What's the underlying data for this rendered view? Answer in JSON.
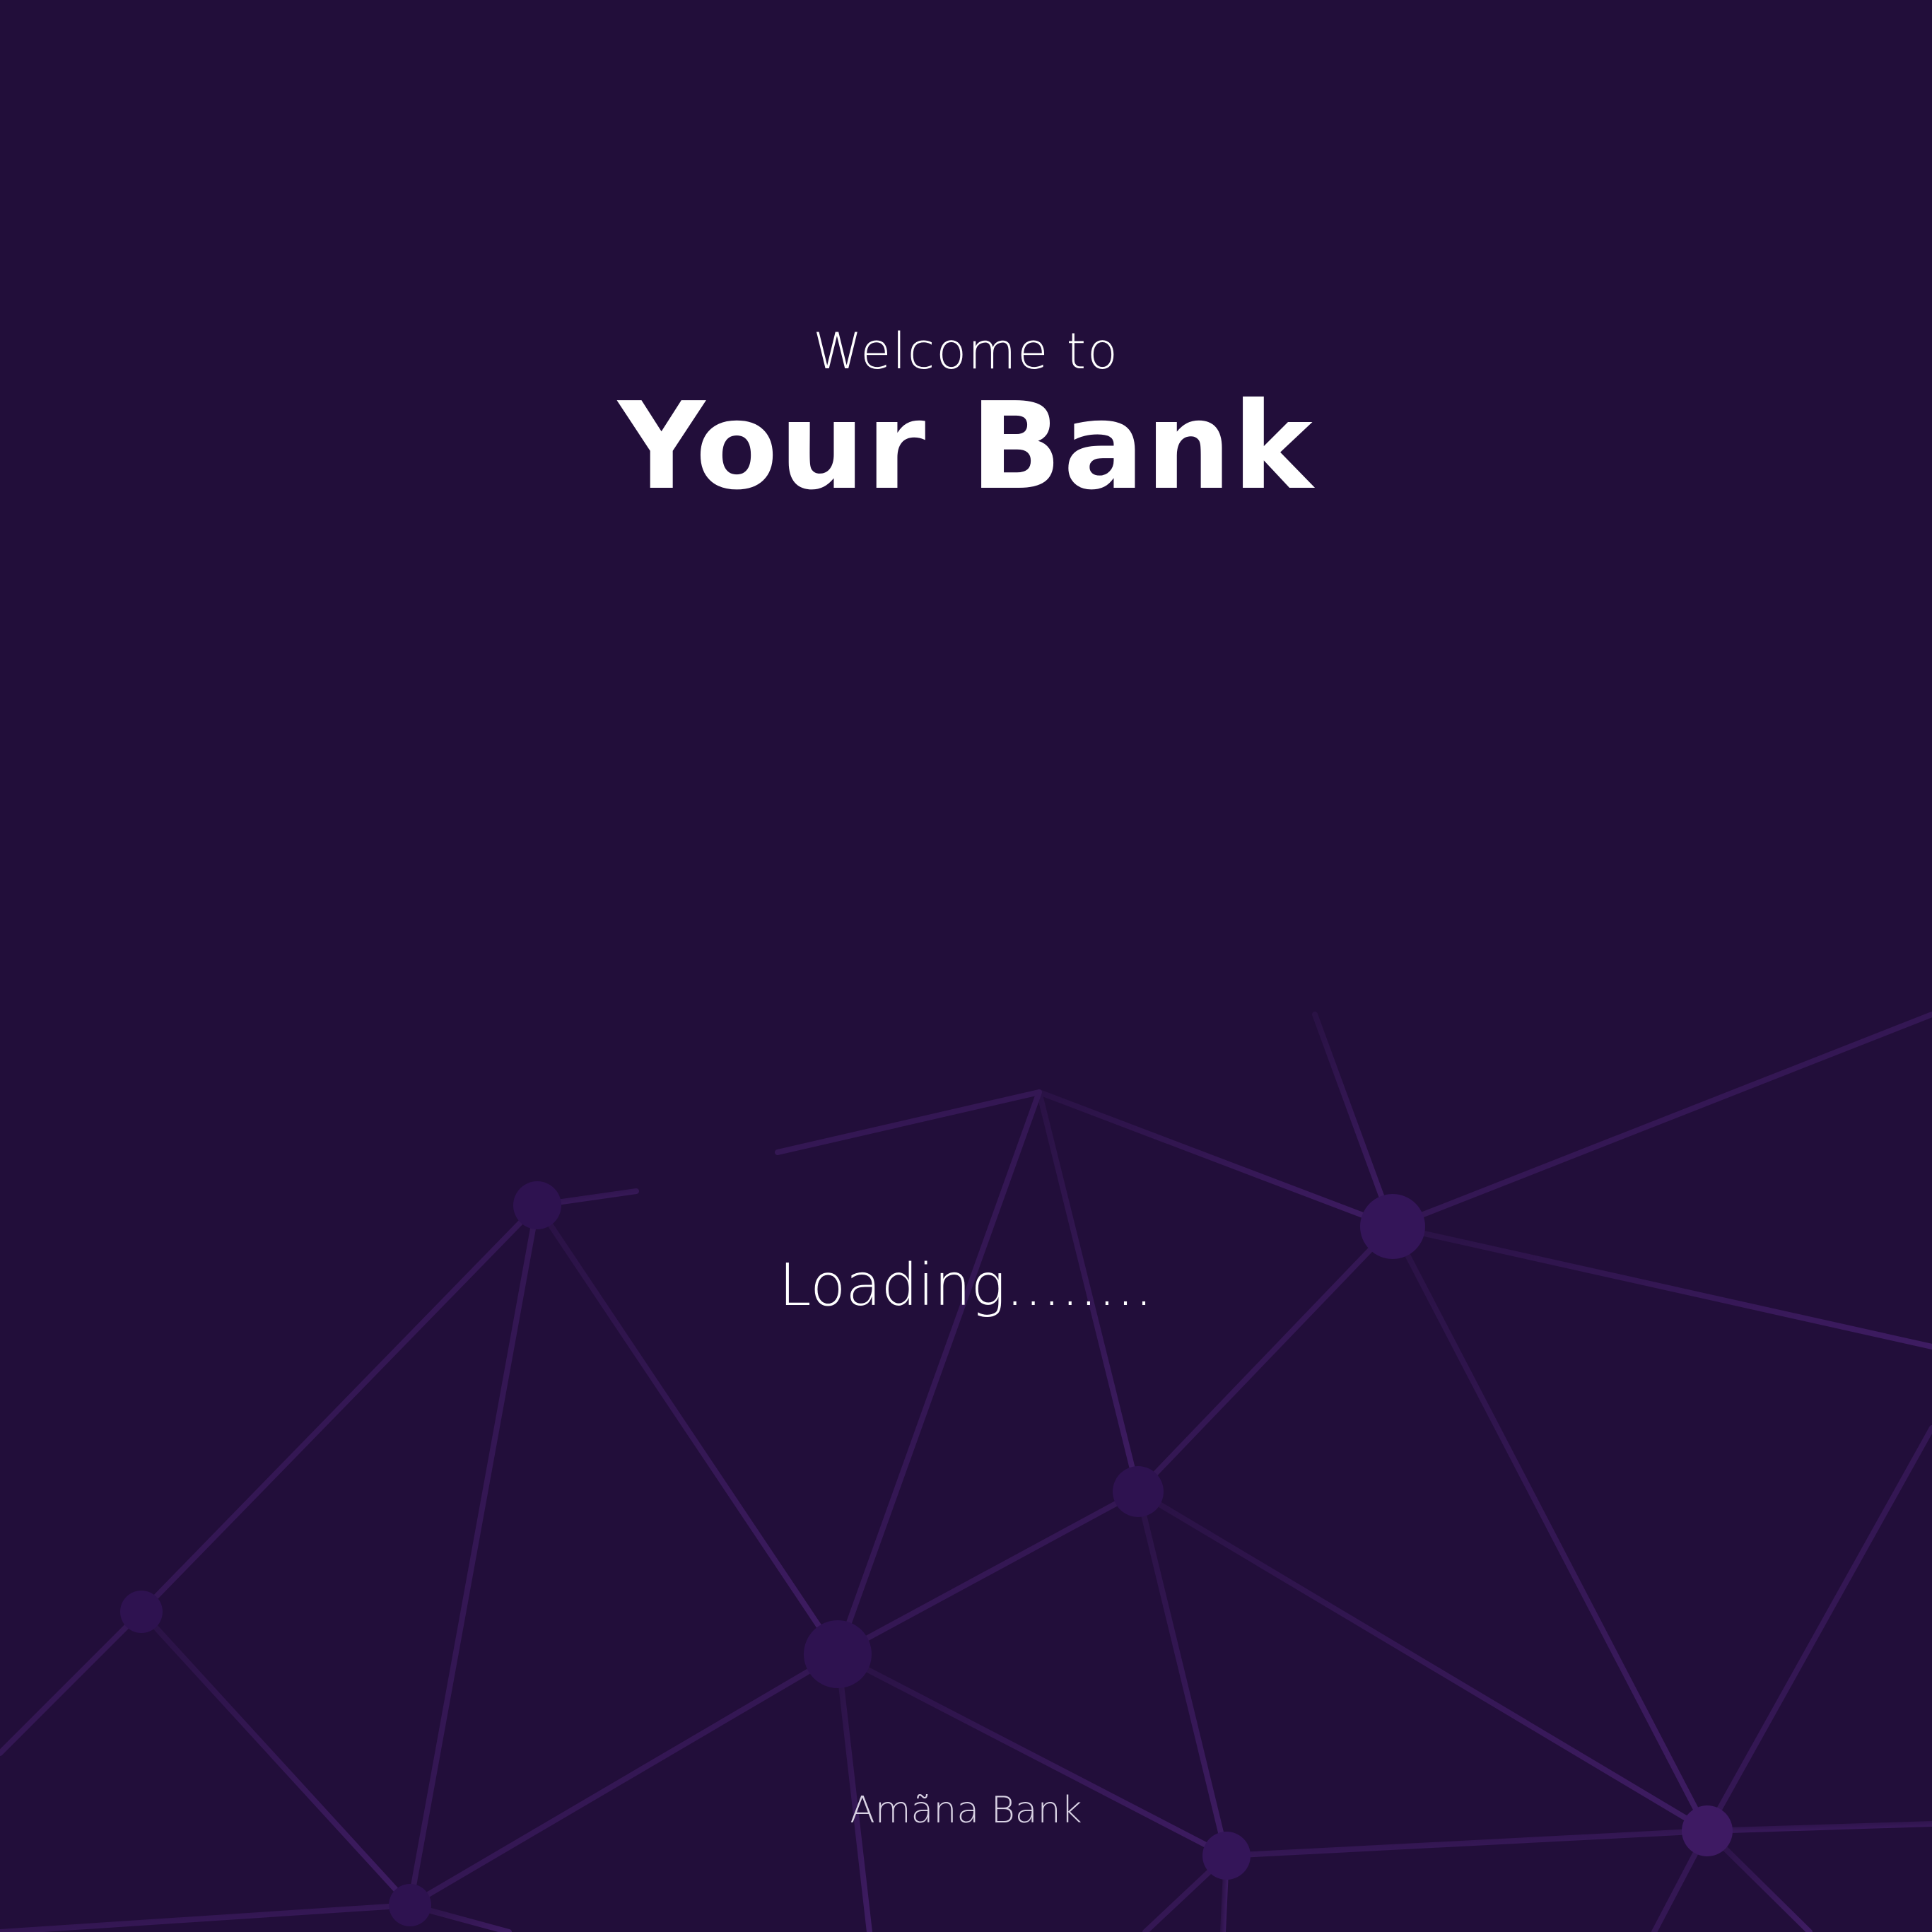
{
  "splash": {
    "greeting": "Welcome to",
    "title": "Your Bank",
    "status": "Loading........",
    "footer": "Amãna Bank"
  },
  "colors": {
    "background": "#220e3a",
    "network_line": "#3d1a5e",
    "text": "#ffffff"
  },
  "decoration": {
    "background_graphic": "network-graph-pattern"
  }
}
